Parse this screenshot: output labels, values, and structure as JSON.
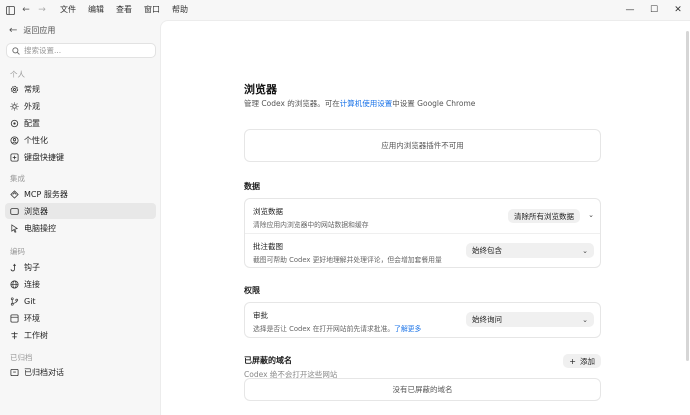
{
  "titlebar": {
    "menu": [
      "文件",
      "编辑",
      "查看",
      "窗口",
      "帮助"
    ],
    "icons": [
      "sidebar-toggle-icon",
      "back-arrow-icon",
      "forward-arrow-icon",
      "minimize-icon",
      "maximize-icon",
      "close-icon"
    ]
  },
  "sidebar": {
    "back_label": "返回应用",
    "search_placeholder": "搜索设置...",
    "groups": {
      "personal": "个人",
      "integrations": "集成",
      "coding": "编码",
      "archived": "已归档"
    },
    "items": {
      "general": "常规",
      "appearance": "外观",
      "config": "配置",
      "personalization": "个性化",
      "shortcuts": "键盘快捷键",
      "mcp": "MCP 服务器",
      "browser": "浏览器",
      "computer": "电脑操控",
      "hooks": "钩子",
      "connections": "连接",
      "git": "Git",
      "environment": "环境",
      "worktree": "工作树",
      "archived_chats": "已归档对话"
    },
    "active_item": "browser"
  },
  "main": {
    "title": "浏览器",
    "desc_prefix": "管理 Codex 的浏览器。可在",
    "desc_link": "计算机使用设置",
    "desc_suffix": "中设置 Google Chrome",
    "notice": "应用内浏览器插件不可用",
    "data_section": {
      "title": "数据",
      "browse_data_title": "浏览数据",
      "browse_data_desc": "清除应用内浏览器中的网站数据和缓存",
      "clear_button": "清除所有浏览数据",
      "annot_title": "批注截图",
      "annot_desc": "截图可帮助 Codex 更好地理解并处理评论，但会增加套餐用量",
      "annot_value": "始终包含"
    },
    "perm_section": {
      "title": "权限",
      "approval_title": "审批",
      "approval_desc": "选择是否让 Codex 在打开网站前先请求批准。",
      "approval_link": "了解更多",
      "approval_value": "始终询问"
    },
    "blocked_section": {
      "title": "已屏蔽的域名",
      "desc": "Codex 绝不会打开这些网站",
      "add_button": "添加",
      "empty": "没有已屏蔽的域名"
    }
  }
}
